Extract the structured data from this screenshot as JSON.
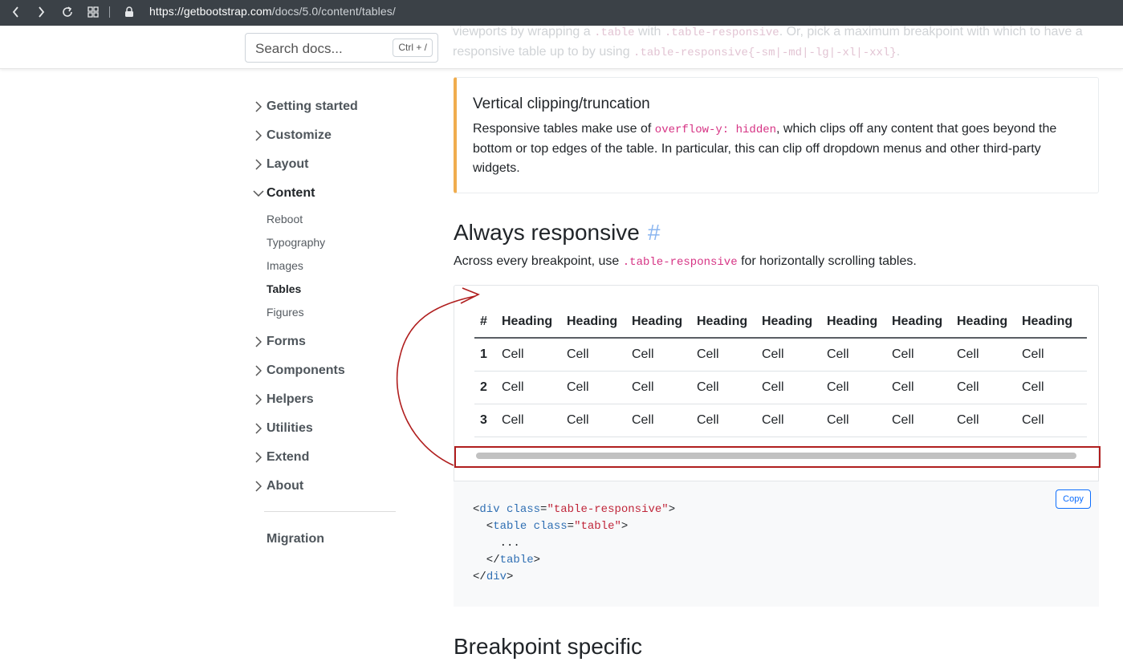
{
  "browser": {
    "url_host": "https://getbootstrap.com",
    "url_path": "/docs/5.0/content/tables/",
    "icons": [
      "back-icon",
      "forward-icon",
      "reload-icon",
      "grid-icon",
      "lock-icon"
    ]
  },
  "top_ghost": {
    "line1_pre": "viewports by wrapping a",
    "line1_code1": ".table",
    "line1_mid": "with",
    "line1_code2": ".table-responsive",
    "line1_post": ". Or, pick a maximum breakpoint with which to have a",
    "line2_pre": "responsive table up to by using",
    "line2_code": ".table-responsive{-sm|-md|-lg|-xl|-xxl}",
    "line2_post": "."
  },
  "search": {
    "placeholder": "Search docs...",
    "shortcut": "Ctrl + /"
  },
  "sidebar": {
    "items": [
      {
        "label": "Getting started",
        "expanded": false
      },
      {
        "label": "Customize",
        "expanded": false
      },
      {
        "label": "Layout",
        "expanded": false
      },
      {
        "label": "Content",
        "expanded": true
      },
      {
        "label": "Forms",
        "expanded": false
      },
      {
        "label": "Components",
        "expanded": false
      },
      {
        "label": "Helpers",
        "expanded": false
      },
      {
        "label": "Utilities",
        "expanded": false
      },
      {
        "label": "Extend",
        "expanded": false
      },
      {
        "label": "About",
        "expanded": false
      }
    ],
    "content_subitems": [
      "Reboot",
      "Typography",
      "Images",
      "Tables",
      "Figures"
    ],
    "active_subitem": "Tables",
    "migration": "Migration"
  },
  "callout": {
    "title": "Vertical clipping/truncation",
    "text_pre": "Responsive tables make use of",
    "code": "overflow-y: hidden",
    "text_post": ", which clips off any content that goes beyond the bottom or top edges of the table. In particular, this can clip off dropdown menus and other third-party widgets."
  },
  "section": {
    "title": "Always responsive",
    "anchor": "#",
    "lead_pre": "Across every breakpoint, use",
    "lead_code": ".table-responsive",
    "lead_post": "for horizontally scrolling tables."
  },
  "table": {
    "headers": [
      "#",
      "Heading",
      "Heading",
      "Heading",
      "Heading",
      "Heading",
      "Heading",
      "Heading",
      "Heading",
      "Heading"
    ],
    "rows": [
      [
        "1",
        "Cell",
        "Cell",
        "Cell",
        "Cell",
        "Cell",
        "Cell",
        "Cell",
        "Cell",
        "Cell"
      ],
      [
        "2",
        "Cell",
        "Cell",
        "Cell",
        "Cell",
        "Cell",
        "Cell",
        "Cell",
        "Cell",
        "Cell"
      ],
      [
        "3",
        "Cell",
        "Cell",
        "Cell",
        "Cell",
        "Cell",
        "Cell",
        "Cell",
        "Cell",
        "Cell"
      ]
    ]
  },
  "code": {
    "copy_label": "Copy",
    "ellipsis": "..."
  },
  "next_section": {
    "title": "Breakpoint specific"
  },
  "colors": {
    "callout_border": "#f0ad4e",
    "annotation_red": "#b01e1e",
    "code_pink": "#d63384",
    "copy_blue": "#0d6efd"
  }
}
